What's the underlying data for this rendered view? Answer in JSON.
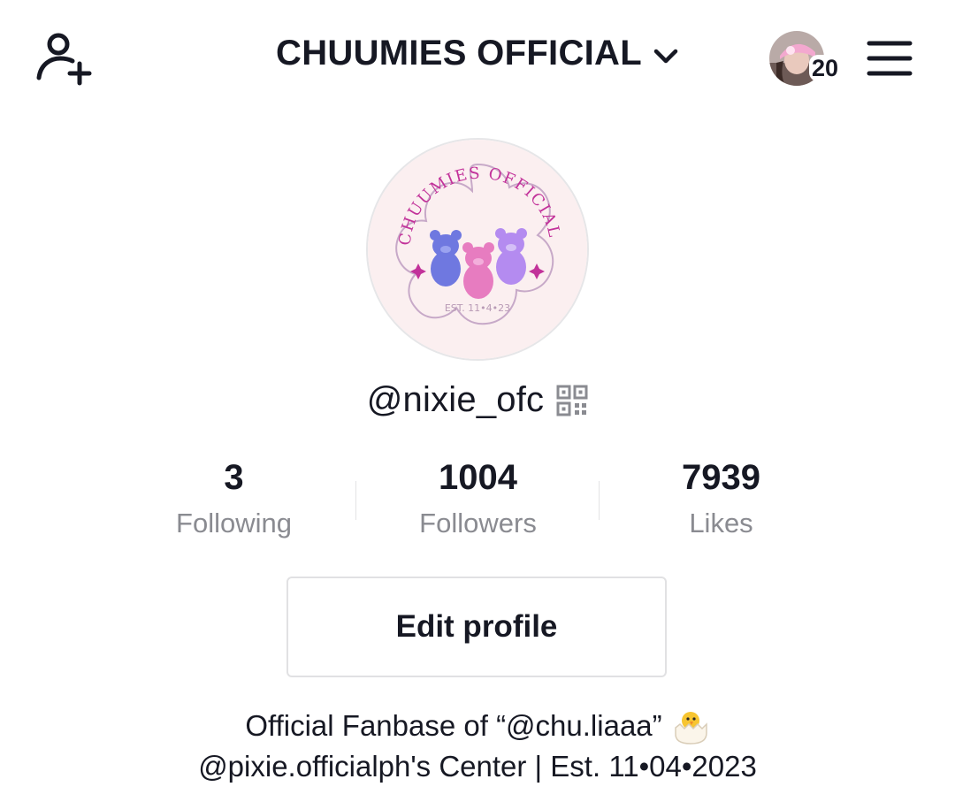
{
  "header": {
    "title": "CHUUMIES OFFICIAL",
    "notification_count": "20",
    "icons": {
      "add_user": "add-user-icon",
      "chevron": "chevron-down-icon",
      "menu": "menu-icon"
    }
  },
  "profile": {
    "avatar_logo_text": "CHUUMIES OFFICIAL",
    "avatar_est": "EST. 11•4•23",
    "handle": "@nixie_ofc",
    "stats": [
      {
        "value": "3",
        "label": "Following"
      },
      {
        "value": "1004",
        "label": "Followers"
      },
      {
        "value": "7939",
        "label": "Likes"
      }
    ],
    "edit_button": "Edit profile",
    "bio": {
      "line1": "Official Fanbase of “@chu.liaaa”",
      "line1_emoji": "hatching-chick-emoji",
      "line2": "@pixie.officialph's Center | Est. 11•04•2023"
    }
  },
  "colors": {
    "text": "#161823",
    "secondary_text": "#8a8b91",
    "avatar_bg": "#fbeff0",
    "logo_pink": "#c2329a",
    "bear_blue": "#6f78e0",
    "bear_pink": "#e77cc0",
    "bear_purple": "#b48bf0"
  }
}
